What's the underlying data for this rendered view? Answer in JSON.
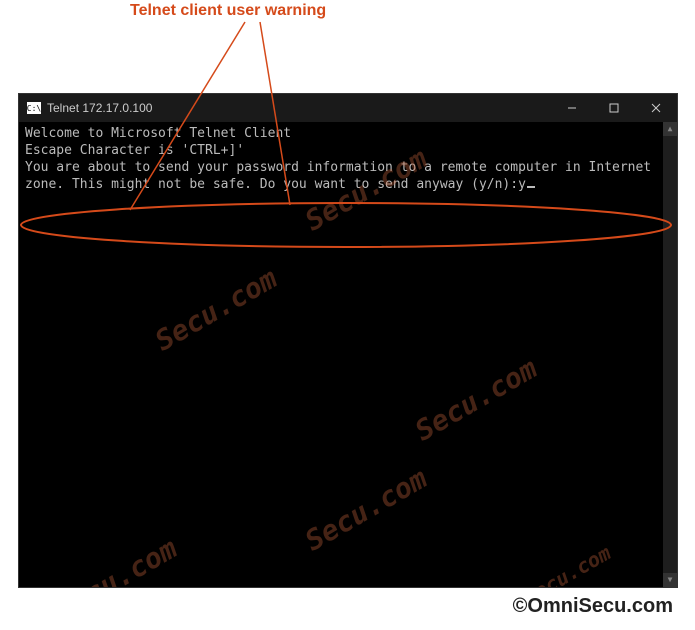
{
  "annotation": {
    "label": "Telnet client user warning"
  },
  "window": {
    "title": "Telnet 172.17.0.100",
    "icon_label": "C:\\"
  },
  "terminal": {
    "line1": "Welcome to Microsoft Telnet Client",
    "line2": "",
    "line3": "Escape Character is 'CTRL+]'",
    "line4": "",
    "line5": "",
    "warning": "You are about to send your password information to a remote computer in Internet zone. This might not be safe. Do you want to send anyway (y/n):",
    "user_input": "y"
  },
  "watermark": {
    "text": "Secu.com"
  },
  "credit": {
    "text": "©OmniSecu.com"
  }
}
